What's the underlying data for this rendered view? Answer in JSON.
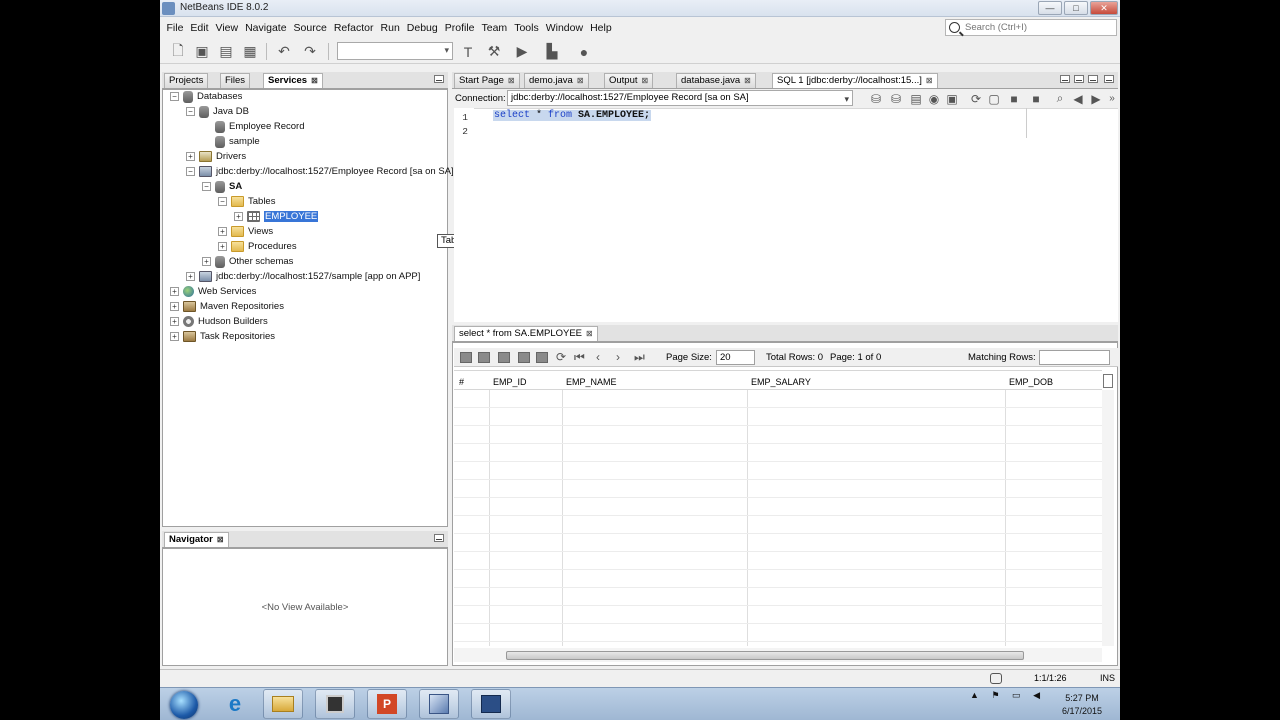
{
  "window": {
    "title": "NetBeans IDE 8.0.2",
    "buttons": [
      "—",
      "□",
      "✕"
    ]
  },
  "menu": [
    "File",
    "Edit",
    "View",
    "Navigate",
    "Source",
    "Refactor",
    "Run",
    "Debug",
    "Profile",
    "Team",
    "Tools",
    "Window",
    "Help"
  ],
  "search": {
    "placeholder": "Search (Ctrl+I)"
  },
  "left_panel": {
    "tabs": [
      {
        "label": "Projects"
      },
      {
        "label": "Files"
      },
      {
        "label": "Services",
        "close": "⊠"
      }
    ]
  },
  "tree": [
    {
      "label": "Databases",
      "icon": "database-icon"
    },
    {
      "label": "Java DB",
      "icon": "database-icon"
    },
    {
      "label": "Employee Record",
      "icon": "database-icon"
    },
    {
      "label": "sample",
      "icon": "database-icon"
    },
    {
      "label": "Drivers",
      "icon": "driver-icon"
    },
    {
      "label": "jdbc:derby://localhost:1527/Employee Record [sa on SA]",
      "icon": "connection-icon"
    },
    {
      "label": "SA",
      "icon": "schema-icon"
    },
    {
      "label": "Tables",
      "icon": "folder-icon"
    },
    {
      "label": "EMPLOYEE",
      "icon": "table-icon"
    },
    {
      "label": "Views",
      "icon": "folder-icon"
    },
    {
      "label": "Procedures",
      "icon": "folder-icon"
    },
    {
      "label": "Other schemas",
      "icon": "schema-icon"
    },
    {
      "label": "jdbc:derby://localhost:1527/sample [app on APP]",
      "icon": "connection-icon"
    },
    {
      "label": "Web Services",
      "icon": "globe-icon"
    },
    {
      "label": "Maven Repositories",
      "icon": "box-icon"
    },
    {
      "label": "Hudson Builders",
      "icon": "gear-icon"
    },
    {
      "label": "Task Repositories",
      "icon": "box-icon"
    }
  ],
  "tooltip": "Table",
  "navigator": {
    "title": "Navigator",
    "close": "⊠",
    "empty": "<No View Available>"
  },
  "editor": {
    "tabs": [
      {
        "label": "Start Page"
      },
      {
        "label": "demo.java"
      },
      {
        "label": "Output"
      },
      {
        "label": "database.java"
      },
      {
        "label": "SQL 1 [jdbc:derby://localhost:15...]"
      }
    ],
    "connection_label": "Connection:",
    "connection_value": "jdbc:derby://localhost:1527/Employee Record [sa on SA]",
    "line_numbers": [
      "1",
      "2"
    ],
    "sql": {
      "kw1": "select",
      "star": " * ",
      "kw2": "from",
      "table": " SA.EMPLOYEE;"
    }
  },
  "results": {
    "tab": "select * from SA.EMPLOYEE",
    "page_size_label": "Page Size:",
    "page_size_value": "20",
    "total_rows": "Total Rows: 0",
    "page_info": "Page: 1 of 0",
    "matching_label": "Matching Rows:",
    "columns": [
      "#",
      "EMP_ID",
      "EMP_NAME",
      "EMP_SALARY",
      "EMP_DOB"
    ]
  },
  "status": {
    "position": "1:1/1:26",
    "mode": "INS"
  },
  "taskbar": {
    "apps": [
      "ie-icon",
      "explorer-icon",
      "media-player-icon",
      "powerpoint-icon",
      "netbeans-icon",
      "app-icon"
    ],
    "time": "5:27 PM",
    "date": "6/17/2015"
  }
}
